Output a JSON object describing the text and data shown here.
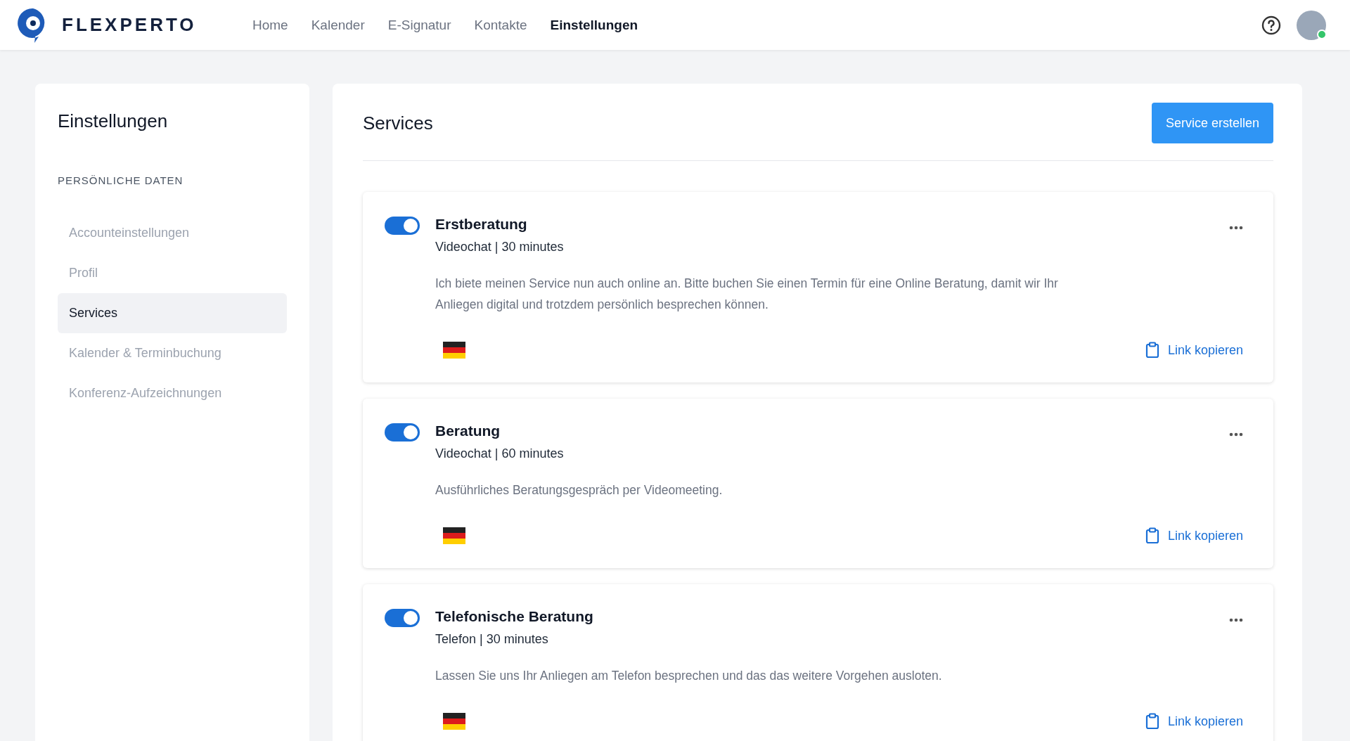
{
  "header": {
    "brand": "FLEXPERTO",
    "nav": [
      {
        "label": "Home",
        "selected": false
      },
      {
        "label": "Kalender",
        "selected": false
      },
      {
        "label": "E-Signatur",
        "selected": false
      },
      {
        "label": "Kontakte",
        "selected": false
      },
      {
        "label": "Einstellungen",
        "selected": true
      }
    ],
    "avatar": {
      "online": true
    }
  },
  "sidebar": {
    "title": "Einstellungen",
    "section": "PERSÖNLICHE DATEN",
    "items": [
      {
        "label": "Accounteinstellungen",
        "selected": false
      },
      {
        "label": "Profil",
        "selected": false
      },
      {
        "label": "Services",
        "selected": true
      },
      {
        "label": "Kalender & Terminbuchung",
        "selected": false
      },
      {
        "label": "Konferenz-Aufzeichnungen",
        "selected": false
      }
    ]
  },
  "main": {
    "title": "Services",
    "create_button": "Service erstellen",
    "services": [
      {
        "name": "Erstberatung",
        "meta": "Videochat | 30 minutes",
        "description": "Ich biete meinen Service nun auch online an. Bitte buchen Sie einen Termin für eine Online Beratung, damit wir Ihr Anliegen digital und trotzdem persönlich besprechen können.",
        "on": true,
        "link": "Link kopieren"
      },
      {
        "name": "Beratung",
        "meta": "Videochat | 60 minutes",
        "description": "Ausführliches Beratungsgespräch per Videomeeting.",
        "on": true,
        "link": "Link kopieren"
      },
      {
        "name": "Telefonische Beratung",
        "meta": "Telefon | 30 minutes",
        "description": "Lassen Sie uns Ihr Anliegen am Telefon besprechen und das das weitere Vorgehen ausloten.",
        "on": true,
        "link": "Link kopieren"
      }
    ]
  }
}
